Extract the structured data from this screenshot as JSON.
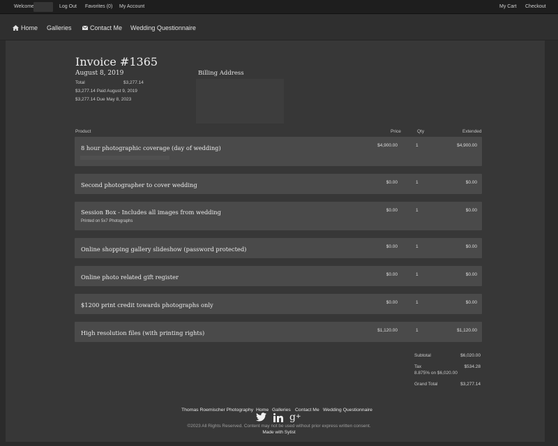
{
  "topbar": {
    "welcome": "Welcome",
    "logout": "Log Out",
    "favorites": "Favorites (0)",
    "my_account": "My Account",
    "my_cart": "My Cart",
    "checkout": "Checkout"
  },
  "nav": {
    "home": "Home",
    "galleries": "Galleries",
    "contact": "Contact Me",
    "questionnaire": "Wedding Questionnaire"
  },
  "invoice": {
    "title": "Invoice #1365",
    "date": "August 8, 2019",
    "total_label": "Total",
    "total_value": "$3,277.14",
    "paid_line": "$3,277.14 Paid August 9, 2019",
    "due_line": "$3,277.14 Due May 8, 2023",
    "billing_label": "Billing Address"
  },
  "table": {
    "headers": {
      "product": "Product",
      "price": "Price",
      "qty": "Qty",
      "extended": "Extended"
    },
    "rows": [
      {
        "name": "8 hour photographic coverage (day of wedding)",
        "note": "",
        "price": "$4,900.00",
        "qty": "1",
        "extended": "$4,900.00"
      },
      {
        "name": "Second photographer to cover wedding",
        "note": "",
        "price": "$0.00",
        "qty": "1",
        "extended": "$0.00"
      },
      {
        "name": "Session Box - Includes all images from wedding",
        "note": "Printed on 5x7 Photographs",
        "price": "$0.00",
        "qty": "1",
        "extended": "$0.00"
      },
      {
        "name": "Online shopping gallery slideshow (password protected)",
        "note": "",
        "price": "$0.00",
        "qty": "1",
        "extended": "$0.00"
      },
      {
        "name": "Online photo related gift register",
        "note": "",
        "price": "$0.00",
        "qty": "1",
        "extended": "$0.00"
      },
      {
        "name": "$1200 print credit towards photographs only",
        "note": "",
        "price": "$0.00",
        "qty": "1",
        "extended": "$0.00"
      },
      {
        "name": "High resolution files (with printing rights)",
        "note": "",
        "price": "$1,120.00",
        "qty": "1",
        "extended": "$1,120.00"
      }
    ]
  },
  "totals": {
    "subtotal_label": "Subtotal",
    "subtotal_value": "$6,020.00",
    "tax_label": "Tax",
    "tax_value": "$534.28",
    "tax_detail": "8.875% on $6,020.00",
    "grand_label": "Grand Total",
    "grand_value": "$3,277.14"
  },
  "footer": {
    "studio": "Thomas Roemischer Photography",
    "home": "Home",
    "galleries": "Galleries",
    "contact": "Contact Me",
    "questionnaire": "Wedding Questionnaire",
    "copyright": "©2023 All Rights Reserved. Content may not be used without prior express written consent.",
    "made_with": "Made with Sytist"
  },
  "icons": [
    "home-icon",
    "envelope-icon",
    "twitter-icon",
    "linkedin-icon",
    "google-plus-icon"
  ]
}
